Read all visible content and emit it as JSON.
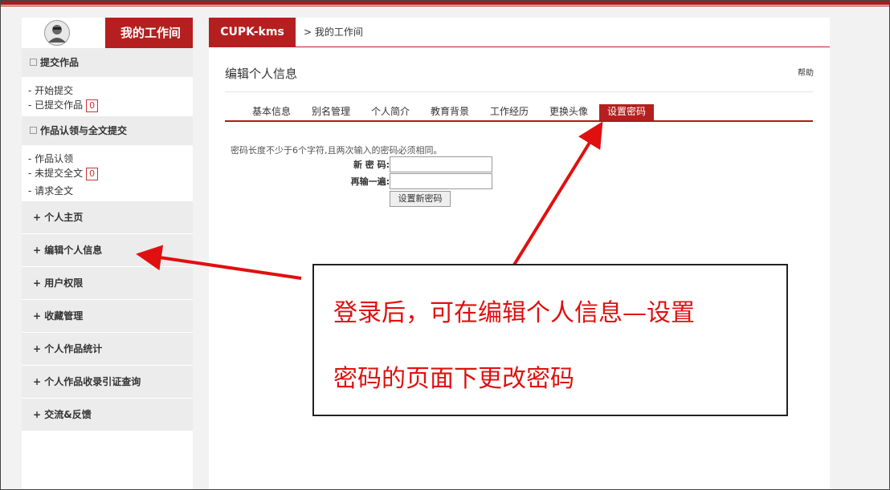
{
  "sidebar": {
    "title": "我的工作间",
    "sections": [
      {
        "label": "提交作品",
        "items": [
          {
            "label": "- 开始提交"
          },
          {
            "label": "- 已提交作品",
            "count": "0"
          }
        ]
      },
      {
        "label": "作品认领与全文提交",
        "items": [
          {
            "label": "- 作品认领"
          },
          {
            "label": "- 未提交全文",
            "count": "0"
          },
          {
            "label": "- 请求全文"
          }
        ]
      }
    ],
    "menu": [
      {
        "label": "+ 个人主页"
      },
      {
        "label": "+ 编辑个人信息"
      },
      {
        "label": "+ 用户权限"
      },
      {
        "label": "+ 收藏管理"
      },
      {
        "label": "+ 个人作品统计"
      },
      {
        "label": "+ 个人作品收录引证查询"
      },
      {
        "label": "+ 交流&反馈"
      }
    ]
  },
  "header": {
    "brand": "CUPK-kms",
    "breadcrumb": "> 我的工作间"
  },
  "main": {
    "title": "编辑个人信息",
    "help": "帮助",
    "tabs": [
      {
        "label": "基本信息"
      },
      {
        "label": "别名管理"
      },
      {
        "label": "个人简介"
      },
      {
        "label": "教育背景"
      },
      {
        "label": "工作经历"
      },
      {
        "label": "更换头像"
      },
      {
        "label": "设置密码",
        "active": true
      }
    ],
    "hint": "密码长度不少于6个字符,且两次输入的密码必须相同。",
    "new_password_label": "新 密 码:",
    "confirm_password_label": "再输一遍:",
    "submit_label": "设置新密码"
  },
  "annotation": {
    "line1": "登录后，可在编辑个人信息—设置",
    "line2": "密码的页面下更改密码",
    "color": "#e01010"
  },
  "colors": {
    "brand": "#b51f1f"
  }
}
